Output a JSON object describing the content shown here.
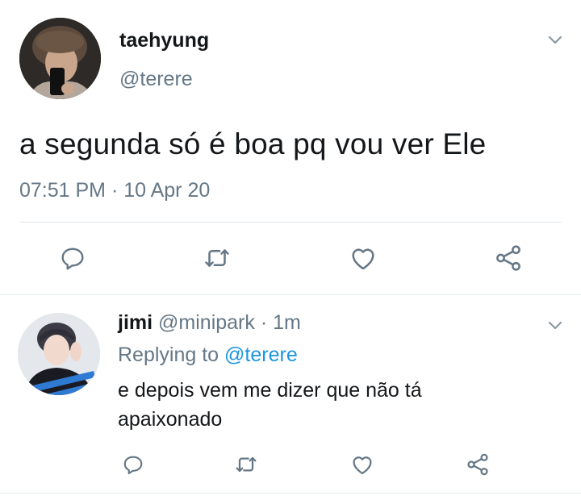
{
  "main_tweet": {
    "author_name": "taehyung",
    "author_handle": "@terere",
    "text": "a segunda só é boa pq vou ver Ele",
    "timestamp": "07:51 PM · 10 Apr 20",
    "icons": [
      "chevron-down-icon",
      "reply-icon",
      "retweet-icon",
      "like-icon",
      "share-icon"
    ]
  },
  "reply_tweet": {
    "author_name": "jimi",
    "author_handle": "@minipark",
    "separator": " · ",
    "relative_time": "1m",
    "replying_prefix": "Replying to ",
    "replying_handle": "@terere",
    "text": "e depois vem me dizer que não tá apaixonado",
    "icons": [
      "chevron-down-icon",
      "reply-icon",
      "retweet-icon",
      "like-icon",
      "share-icon"
    ]
  },
  "colors": {
    "text_primary": "#14171a",
    "text_secondary": "#657786",
    "link": "#1b95e0",
    "divider": "#e1e8ed",
    "icon": "#657786"
  }
}
